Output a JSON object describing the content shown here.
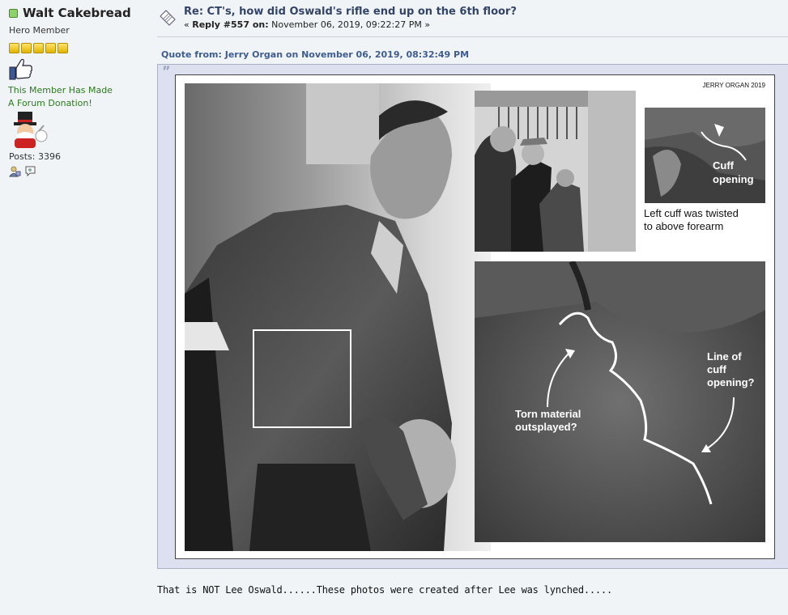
{
  "poster": {
    "name": "Walt Cakebread",
    "rank": "Hero Member",
    "star_count": 5,
    "donation_line1": "This Member Has Made",
    "donation_line2": "A Forum Donation!",
    "posts": "Posts: 3396",
    "online_color": "#8fd16a"
  },
  "post": {
    "subject": "Re: CT's, how did Oswald's rifle end up on the 6th floor?",
    "reply_prefix": "« ",
    "reply_label": "Reply #557 on:",
    "reply_date": " November 06, 2019, 09:22:27 PM »",
    "body": "That is NOT Lee Oswald......These photos were created after Lee was lynched....."
  },
  "quote": {
    "header": "Quote from: Jerry Organ on November 06, 2019, 08:32:49 PM",
    "mark": "”",
    "image": {
      "credit": "JERRY ORGAN 2019",
      "cuff_label_line1": "Cuff",
      "cuff_label_line2": "opening",
      "caption_line1": "Left cuff was twisted",
      "caption_line2": "to above forearm",
      "line_label_1": "Line of",
      "line_label_2": "cuff",
      "line_label_3": "opening?",
      "torn_label_1": "Torn material",
      "torn_label_2": "outsplayed?"
    }
  },
  "icons": {
    "topic": "topic-icon",
    "thumbs": "thumbs-up-icon",
    "mascot": "mascot-avatar-icon",
    "profile": "profile-icon",
    "message": "message-icon"
  },
  "colors": {
    "subject": "#334466",
    "quote_header": "#3e5d8e",
    "quote_bg": "#dde0ee",
    "donation": "#2c7a1f"
  }
}
